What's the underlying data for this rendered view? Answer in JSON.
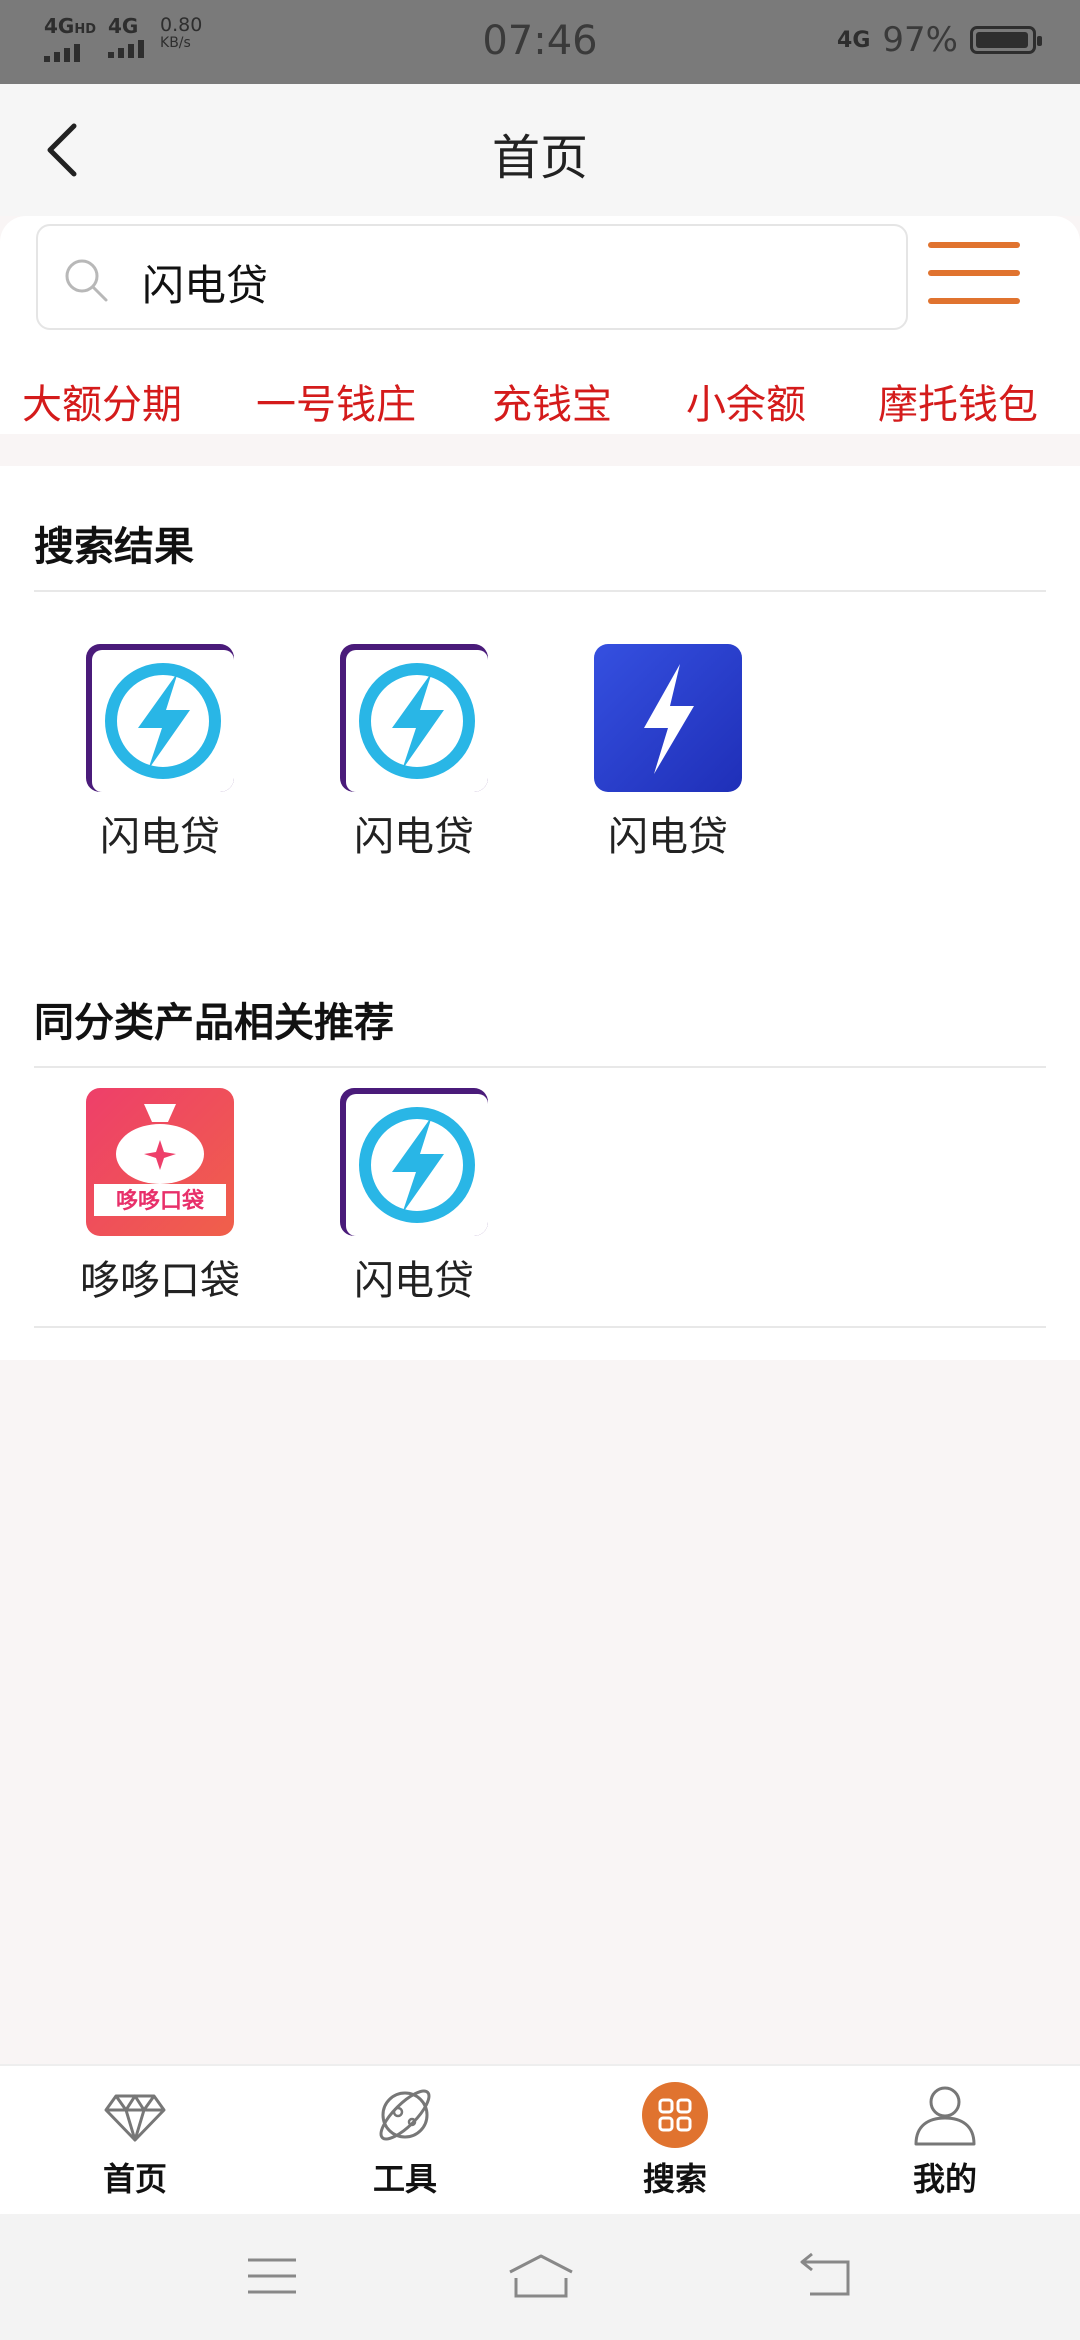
{
  "status_bar": {
    "sig1": "4G",
    "sig1_sup": "HD",
    "sig2": "4G",
    "net_speed": "0.80",
    "net_unit": "KB/s",
    "time": "07:46",
    "net_type": "4G",
    "battery": "97%"
  },
  "header": {
    "title": "首页"
  },
  "search": {
    "value": "闪电贷",
    "placeholder": ""
  },
  "tags": [
    "大额分期",
    "一号钱庄",
    "充钱宝",
    "小余额",
    "摩托钱包"
  ],
  "results": {
    "title": "搜索结果",
    "items": [
      {
        "label": "闪电贷",
        "icon": "lightning-purple-circle-icon"
      },
      {
        "label": "闪电贷",
        "icon": "lightning-purple-circle-icon"
      },
      {
        "label": "闪电贷",
        "icon": "lightning-blue-square-icon"
      }
    ]
  },
  "recommend": {
    "title": "同分类产品相关推荐",
    "items": [
      {
        "label": "哆哆口袋",
        "icon": "money-bag-icon",
        "icon_text": "哆哆口袋"
      },
      {
        "label": "闪电贷",
        "icon": "lightning-purple-circle-icon"
      }
    ]
  },
  "tabbar": {
    "items": [
      {
        "label": "首页",
        "icon": "diamond-icon"
      },
      {
        "label": "工具",
        "icon": "planet-icon"
      },
      {
        "label": "搜索",
        "icon": "grid-circle-icon",
        "active": true
      },
      {
        "label": "我的",
        "icon": "user-icon"
      }
    ]
  },
  "colors": {
    "accent": "#e0732f",
    "tag_red": "#d41b1b",
    "icon_purple": "#4a1b7a",
    "icon_cyan": "#29b6e6",
    "icon_blue": "#2a3fd0"
  }
}
